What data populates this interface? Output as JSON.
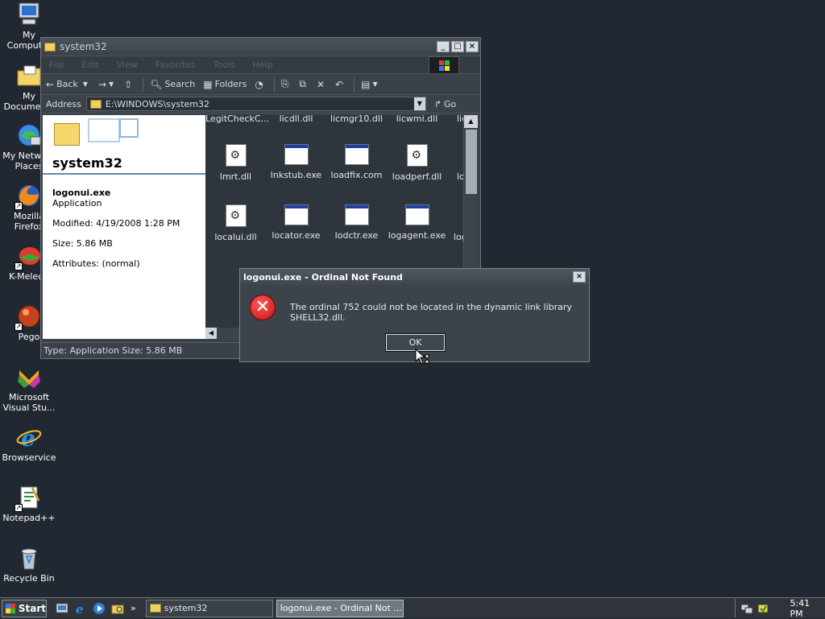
{
  "desktop": {
    "icons": [
      {
        "label": "My Computer",
        "icon": "my-computer-icon"
      },
      {
        "label": "My Documents",
        "icon": "my-documents-icon"
      },
      {
        "label": "My Network Places",
        "icon": "network-places-icon"
      },
      {
        "label": "Mozilla Firefox",
        "icon": "firefox-icon"
      },
      {
        "label": "K-Meleon",
        "icon": "k-meleon-icon"
      },
      {
        "label": "Pego",
        "icon": "pego-icon"
      },
      {
        "label": "Microsoft Visual Stu...",
        "icon": "visual-studio-icon"
      },
      {
        "label": "Browservice",
        "icon": "browser-icon"
      },
      {
        "label": "Notepad++",
        "icon": "notepadpp-icon"
      },
      {
        "label": "Recycle Bin",
        "icon": "recycle-bin-icon"
      }
    ]
  },
  "explorer": {
    "title": "system32",
    "menu": [
      "File",
      "Edit",
      "View",
      "Favorites",
      "Tools",
      "Help"
    ],
    "toolbar": {
      "back": "Back",
      "search": "Search",
      "folders": "Folders"
    },
    "address": {
      "label": "Address",
      "value": "E:\\WINDOWS\\system32",
      "go": "Go"
    },
    "taskpane": {
      "title": "system32",
      "file_name": "logonui.exe",
      "file_type": "Application",
      "modified": "Modified: 4/19/2008 1:28 PM",
      "size": "Size: 5.86 MB",
      "attributes": "Attributes: (normal)"
    },
    "files_row0": [
      "LegitCheckC...",
      "licdll.dll",
      "licmgr10.dll",
      "licwmi.dll",
      "lic"
    ],
    "files_row1": [
      {
        "name": "lmrt.dll",
        "type": "dll"
      },
      {
        "name": "lnkstub.exe",
        "type": "exe"
      },
      {
        "name": "loadfix.com",
        "type": "exe"
      },
      {
        "name": "loadperf.dll",
        "type": "dll"
      },
      {
        "name": "lo",
        "type": "dll"
      }
    ],
    "files_row2": [
      {
        "name": "localui.dll",
        "type": "dll"
      },
      {
        "name": "locator.exe",
        "type": "exe"
      },
      {
        "name": "lodctr.exe",
        "type": "exe"
      },
      {
        "name": "logagent.exe",
        "type": "exe"
      },
      {
        "name": "log",
        "type": "exe"
      }
    ],
    "status": "Type: Application Size: 5.86 MB"
  },
  "dialog": {
    "title": "logonui.exe - Ordinal Not Found",
    "message": "The ordinal 752 could not be located in the dynamic link library SHELL32.dll.",
    "ok": "OK",
    "close": "×"
  },
  "taskbar": {
    "start": "Start",
    "more": "»",
    "tasks": [
      {
        "label": "system32",
        "active": false
      },
      {
        "label": "logonui.exe - Ordinal Not ...",
        "active": true
      }
    ],
    "clock": "5:41 PM"
  }
}
